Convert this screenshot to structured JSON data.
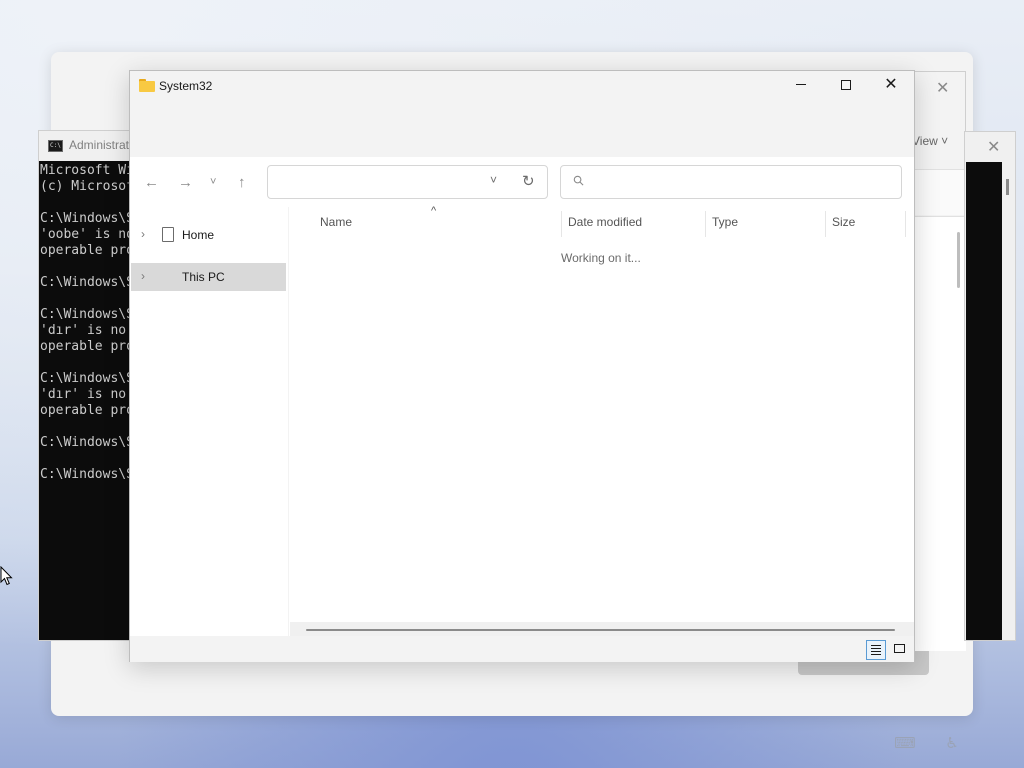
{
  "explorer": {
    "title": "System32",
    "nav": {
      "back_icon": "arrow-left-icon",
      "forward_icon": "arrow-right-icon",
      "recent_icon": "chevron-down-icon",
      "up_icon": "arrow-up-icon",
      "address_value": "",
      "search_placeholder": ""
    },
    "sidebar": {
      "items": [
        {
          "label": "Home",
          "icon": "document-icon",
          "selected": false
        },
        {
          "label": "This PC",
          "icon": "",
          "selected": true
        }
      ]
    },
    "columns": [
      "Name",
      "Date modified",
      "Type",
      "Size"
    ],
    "status_message": "Working on it..."
  },
  "cmd": {
    "title": "Administrator",
    "lines": [
      "Microsoft Wi",
      "(c) Microsof",
      "",
      "C:\\Windows\\S",
      "'oobe' is no",
      "operable pro",
      "",
      "C:\\Windows\\S",
      "",
      "C:\\Windows\\S",
      "'dır' is no",
      "operable pro",
      "",
      "C:\\Windows\\S",
      "'dır' is no",
      "operable pro",
      "",
      "C:\\Windows\\S",
      "",
      "C:\\Windows\\S"
    ]
  },
  "back_explorer": {
    "view_label": "View"
  },
  "colors": {
    "accent": "#5a9bd4",
    "folder": "#f8c942",
    "console_bg": "#0c0c0c",
    "console_text": "#cccccc"
  }
}
